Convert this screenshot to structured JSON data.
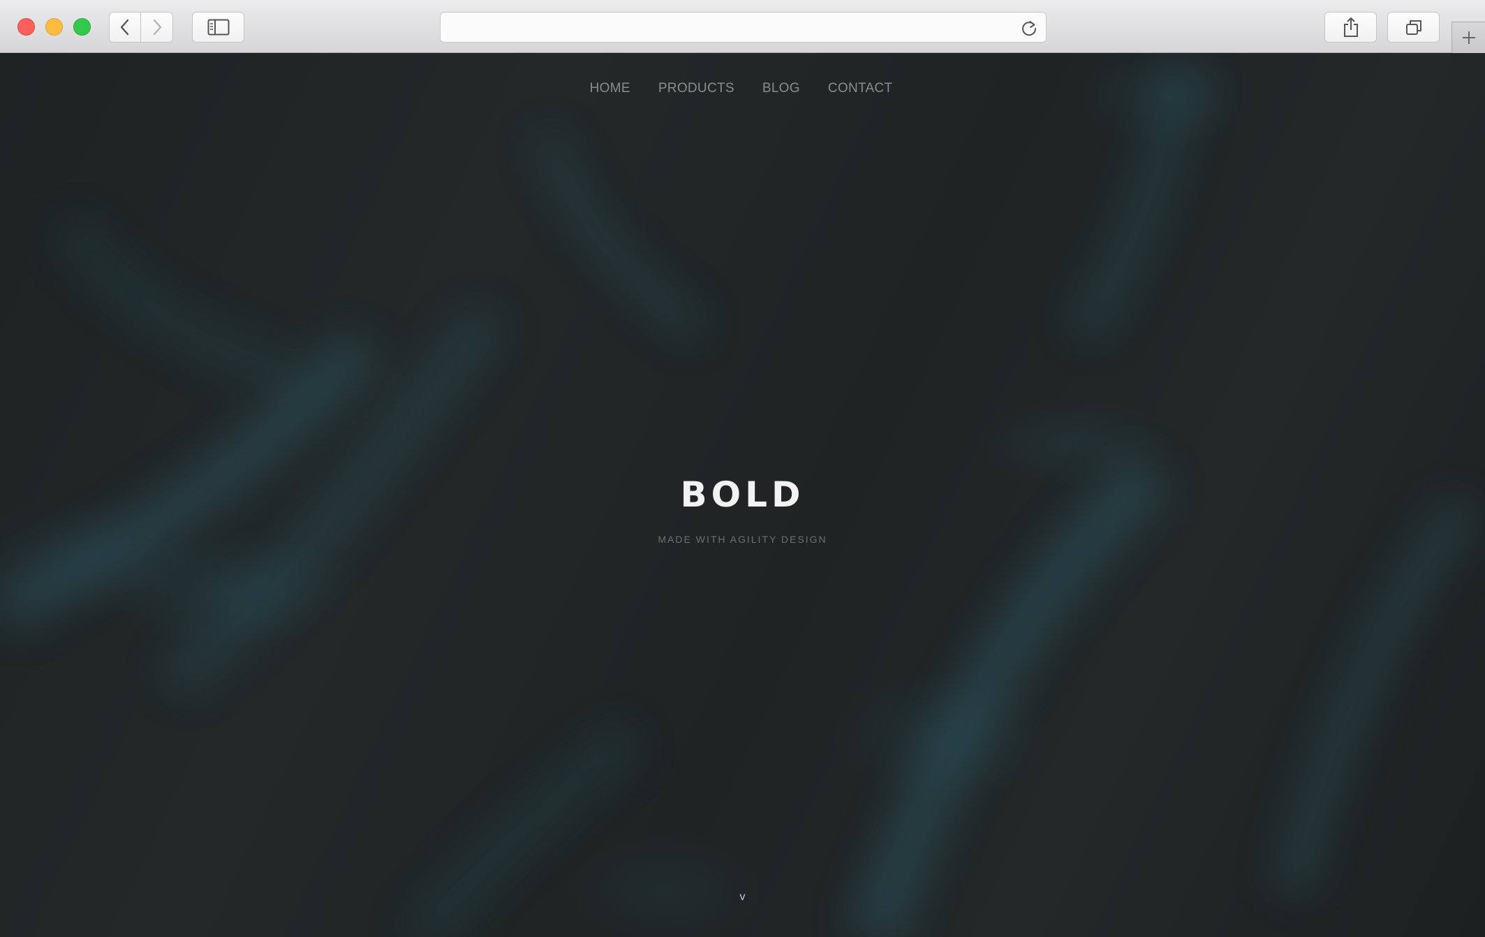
{
  "browser": {
    "url": "",
    "icons": {
      "back": "chevron-left-icon",
      "forward": "chevron-right-icon",
      "sidebar": "sidebar-icon",
      "reload": "reload-icon",
      "share": "share-icon",
      "tabs": "tabs-overview-icon",
      "new_tab": "plus-icon"
    }
  },
  "nav": {
    "items": [
      {
        "label": "HOME"
      },
      {
        "label": "PRODUCTS"
      },
      {
        "label": "BLOG"
      },
      {
        "label": "CONTACT"
      }
    ]
  },
  "hero": {
    "title": "BOLD",
    "subtitle": "MADE WITH AGILITY DESIGN",
    "scroll_indicator": "v"
  },
  "colors": {
    "page_background": "#1f2224",
    "accent_teal": "#28505a",
    "title": "#f2f2f2",
    "nav_text": "#8a8d8e",
    "subtitle": "#6c7071"
  }
}
